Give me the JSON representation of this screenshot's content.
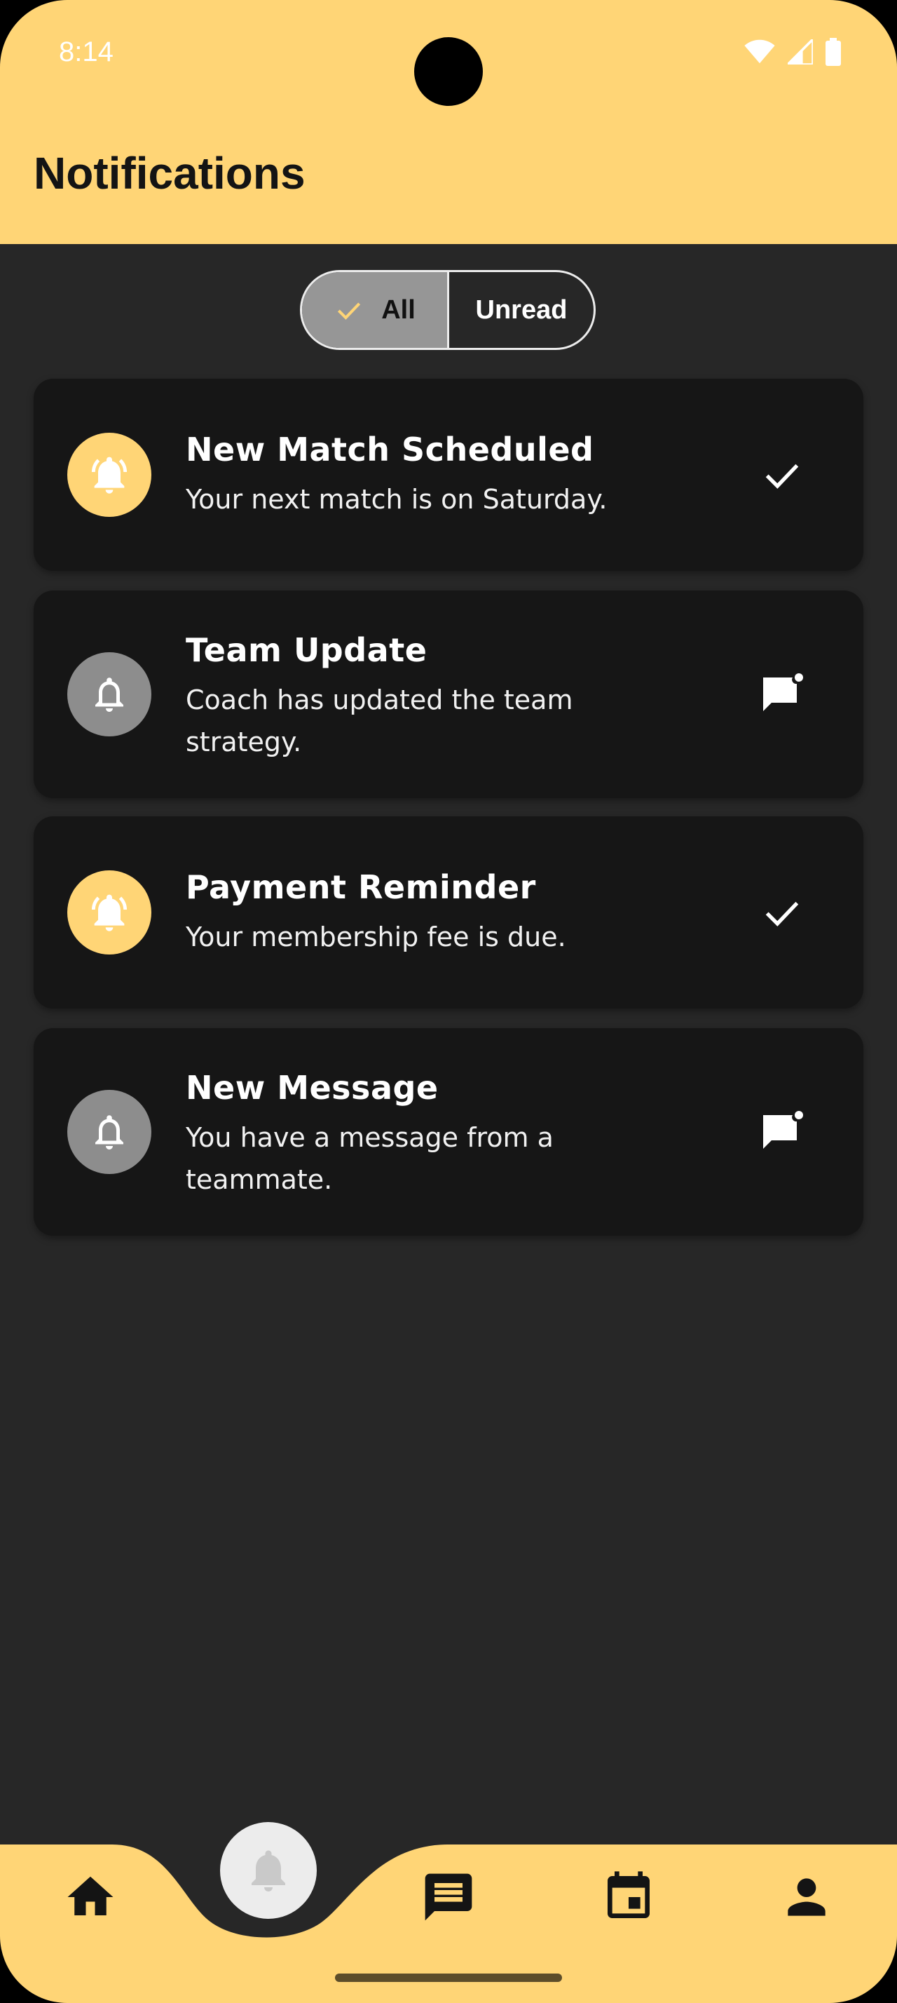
{
  "status_bar": {
    "time": "8:14"
  },
  "header": {
    "title": "Notifications"
  },
  "filter": {
    "all_label": "All",
    "unread_label": "Unread",
    "selected": "All"
  },
  "notifications": [
    {
      "title": "New Match Scheduled",
      "message": "Your next match is on Saturday.",
      "icon": "bell-ring-icon",
      "action_icon": "check-icon",
      "read": true
    },
    {
      "title": "Team Update",
      "message": "Coach has updated the team strategy.",
      "icon": "bell-icon",
      "action_icon": "mark-unread-chat-icon",
      "read": false
    },
    {
      "title": "Payment Reminder",
      "message": "Your membership fee is due.",
      "icon": "bell-ring-icon",
      "action_icon": "check-icon",
      "read": true
    },
    {
      "title": "New Message",
      "message": "You have a message from a teammate.",
      "icon": "bell-icon",
      "action_icon": "mark-unread-chat-icon",
      "read": false
    }
  ],
  "bottom_nav": {
    "items": [
      "home-icon",
      "notifications-icon",
      "chat-icon",
      "calendar-icon",
      "profile-icon"
    ],
    "selected": "notifications-icon"
  },
  "colors": {
    "accent": "#FFD576",
    "background": "#272727",
    "card": "#161616"
  }
}
